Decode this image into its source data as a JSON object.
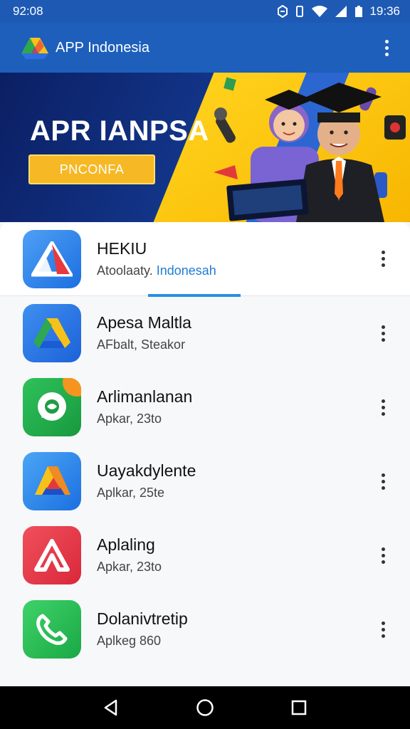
{
  "status_bar": {
    "time_left": "92:08",
    "time_right": "19:36"
  },
  "app_bar": {
    "title": "APP Indonesia",
    "menu_icon": "more-vert-icon"
  },
  "banner": {
    "title": "APR IANPSA",
    "button_label": "PNCONFA"
  },
  "apps": [
    {
      "name": "HEKIU",
      "subtitle_prefix": "Atoolaaty.",
      "subtitle_highlight": "Indonesah",
      "icon": "triangle-red-blue-icon",
      "color": "#2f7fe6"
    },
    {
      "name": "Apesa Maltla",
      "subtitle_prefix": "AFbalt, Steakor",
      "subtitle_highlight": "",
      "icon": "drive-logo-icon",
      "color": "#2a6fdc"
    },
    {
      "name": "Arlimanlanan",
      "subtitle_prefix": "Apkar, 23to",
      "subtitle_highlight": "",
      "icon": "chat-bubble-icon",
      "color": "#22a84b"
    },
    {
      "name": "Uayakdylente",
      "subtitle_prefix": "Aplkar, 25te",
      "subtitle_highlight": "",
      "icon": "triangle-colorful-icon",
      "color": "#2f7fe6"
    },
    {
      "name": "Aplaling",
      "subtitle_prefix": "Apkar, 23to",
      "subtitle_highlight": "",
      "icon": "letter-a-icon",
      "color": "#e33a4a"
    },
    {
      "name": "Dolanivtretip",
      "subtitle_prefix": "Aplkeg 860",
      "subtitle_highlight": "",
      "icon": "phone-icon",
      "color": "#23b24a"
    }
  ],
  "colors": {
    "primary": "#1d5fbb",
    "accent": "#f6b824",
    "tab_indicator": "#2a8ee6"
  }
}
